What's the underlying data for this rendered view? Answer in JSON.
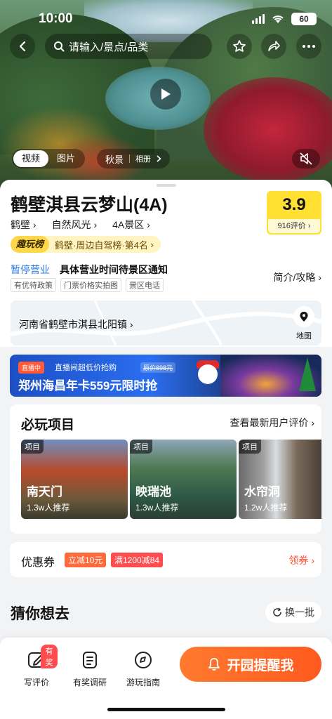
{
  "status_bar": {
    "time": "10:00",
    "battery": "60"
  },
  "search": {
    "placeholder": "请输入/景点/品类"
  },
  "media": {
    "tab_video": "视频",
    "tab_photo": "图片",
    "album_season": "秋景",
    "album_label": "相册"
  },
  "poi": {
    "title": "鹤壁淇县云梦山(4A)",
    "categories": [
      "鹤壁",
      "自然风光",
      "4A景区"
    ],
    "score": "3.9",
    "review_count": "916评价",
    "rank_tag": "趣玩榜",
    "rank_text": "鹤壁·周边自驾榜·第4名",
    "status": "暂停营业",
    "notice": "具体营业时间待景区通知",
    "intro": "简介/攻略",
    "tags": [
      "有优待政策",
      "门票价格实拍图",
      "景区电话"
    ],
    "address": "河南省鹤壁市淇县北阳镇",
    "map_label": "地图"
  },
  "banner": {
    "live": "直播中",
    "line1": "直播间超低价抢购",
    "old_price": "原价898元",
    "line2": "郑州海昌年卡559元限时抢"
  },
  "must_play": {
    "title": "必玩项目",
    "more": "查看最新用户评价",
    "items": [
      {
        "tag": "项目",
        "name": "南天门",
        "rec": "1.3w人推荐"
      },
      {
        "tag": "项目",
        "name": "映瑞池",
        "rec": "1.3w人推荐"
      },
      {
        "tag": "项目",
        "name": "水帘洞",
        "rec": "1.2w人推荐"
      }
    ]
  },
  "coupon": {
    "title": "优惠券",
    "c1": "立减10元",
    "c2": "满1200减84",
    "get": "领券"
  },
  "guess": {
    "title": "猜你想去",
    "refresh": "换一批"
  },
  "bottom": {
    "badge": "有奖",
    "items": [
      "写评价",
      "有奖调研",
      "游玩指南"
    ],
    "cta": "开园提醒我"
  },
  "colors": {
    "accent": "#ff5a1f",
    "score_bg": "#ffe033",
    "status_blue": "#2d7be0"
  }
}
